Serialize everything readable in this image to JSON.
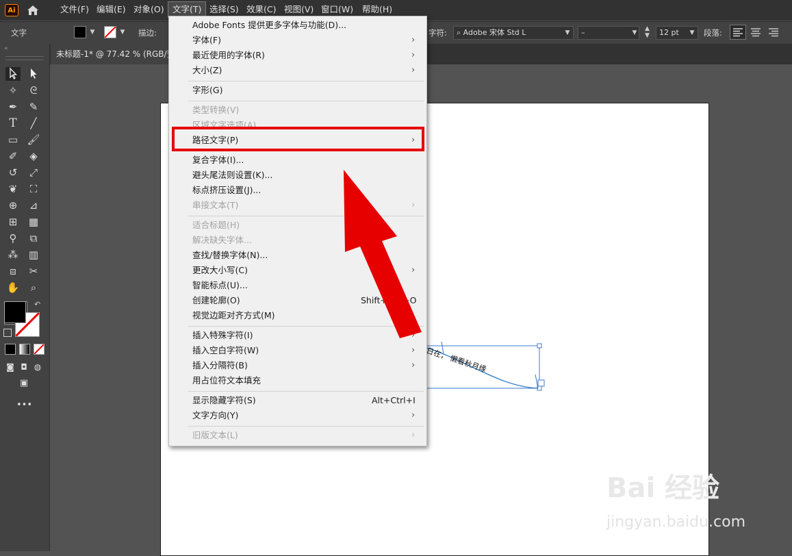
{
  "menubar": {
    "app_icon": "Ai",
    "items": [
      "文件(F)",
      "编辑(E)",
      "对象(O)",
      "文字(T)",
      "选择(S)",
      "效果(C)",
      "视图(V)",
      "窗口(W)",
      "帮助(H)"
    ]
  },
  "controlbar": {
    "tool_label": "文字",
    "stroke_label": "描边:",
    "char_label": "字符:",
    "font_name": "Adobe 宋体 Std L",
    "font_style": "–",
    "font_size": "12 pt",
    "para_label": "段落:"
  },
  "document_tab": {
    "title": "未标题-1* @ 77.42 % (RGB/预览)"
  },
  "canvas": {
    "path_text": "日在，  懒看秋月缘"
  },
  "menu": {
    "items": [
      {
        "label": "Adobe Fonts 提供更多字体与功能(D)...",
        "disabled": false,
        "submenu": false
      },
      {
        "label": "字体(F)",
        "disabled": false,
        "submenu": true
      },
      {
        "label": "最近使用的字体(R)",
        "disabled": false,
        "submenu": true
      },
      {
        "label": "大小(Z)",
        "disabled": false,
        "submenu": true
      },
      {
        "label": "字形(G)",
        "disabled": false,
        "submenu": false
      },
      {
        "label": "类型转换(V)",
        "disabled": true,
        "submenu": false
      },
      {
        "label": "区域文字选项(A)...",
        "disabled": true,
        "submenu": false
      },
      {
        "label": "路径文字(P)",
        "disabled": false,
        "submenu": true,
        "highlighted": true
      },
      {
        "label": "复合字体(I)...",
        "disabled": false,
        "submenu": false
      },
      {
        "label": "避头尾法则设置(K)...",
        "disabled": false,
        "submenu": false
      },
      {
        "label": "标点挤压设置(J)...",
        "disabled": false,
        "submenu": false
      },
      {
        "label": "串接文本(T)",
        "disabled": true,
        "submenu": true
      },
      {
        "label": "适合标题(H)",
        "disabled": true,
        "submenu": false
      },
      {
        "label": "解决缺失字体...",
        "disabled": true,
        "submenu": false
      },
      {
        "label": "查找/替换字体(N)...",
        "disabled": false,
        "submenu": false
      },
      {
        "label": "更改大小写(C)",
        "disabled": false,
        "submenu": true
      },
      {
        "label": "智能标点(U)...",
        "disabled": false,
        "submenu": false
      },
      {
        "label": "创建轮廓(O)",
        "disabled": false,
        "submenu": false,
        "shortcut": "Shift+Ctrl+O"
      },
      {
        "label": "视觉边距对齐方式(M)",
        "disabled": false,
        "submenu": false
      },
      {
        "label": "插入特殊字符(I)",
        "disabled": false,
        "submenu": true
      },
      {
        "label": "插入空白字符(W)",
        "disabled": false,
        "submenu": true
      },
      {
        "label": "插入分隔符(B)",
        "disabled": false,
        "submenu": true
      },
      {
        "label": "用占位符文本填充",
        "disabled": false,
        "submenu": false
      },
      {
        "label": "显示隐藏字符(S)",
        "disabled": false,
        "submenu": false,
        "shortcut": "Alt+Ctrl+I"
      },
      {
        "label": "文字方向(Y)",
        "disabled": false,
        "submenu": true
      },
      {
        "label": "旧版文本(L)",
        "disabled": true,
        "submenu": true
      }
    ]
  },
  "watermark": {
    "brand": "Bai 经验",
    "url": "jingyan.baidu.com"
  },
  "colors": {
    "highlight_box": "#e60000",
    "arrow": "#e60000",
    "path": "#2f78c4"
  }
}
